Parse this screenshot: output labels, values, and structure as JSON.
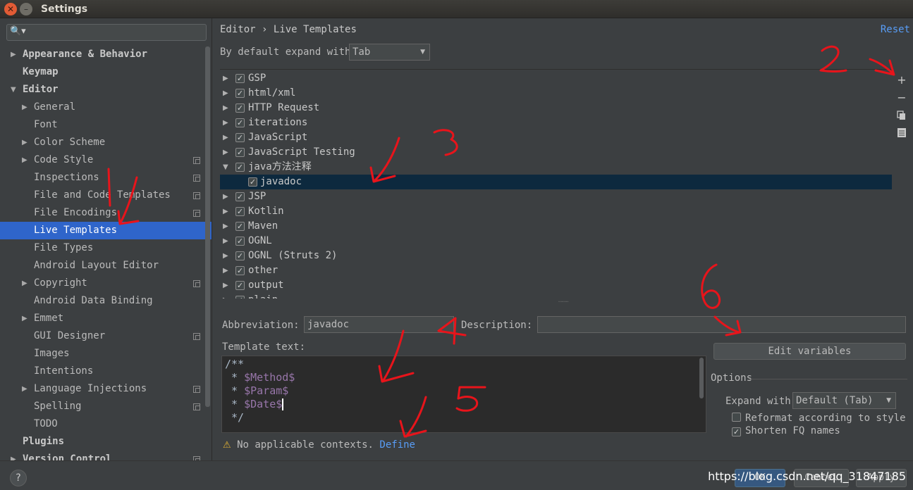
{
  "window": {
    "title": "Settings"
  },
  "search": {
    "placeholder": ""
  },
  "left_tree": [
    {
      "label": "Appearance & Behavior",
      "level": 0,
      "arrow": "right",
      "bold": true,
      "icon": false
    },
    {
      "label": "Keymap",
      "level": 0,
      "arrow": "none",
      "bold": true,
      "icon": false
    },
    {
      "label": "Editor",
      "level": 0,
      "arrow": "down",
      "bold": true,
      "icon": false
    },
    {
      "label": "General",
      "level": 1,
      "arrow": "right",
      "bold": false,
      "icon": false
    },
    {
      "label": "Font",
      "level": 1,
      "arrow": "none",
      "bold": false,
      "icon": false
    },
    {
      "label": "Color Scheme",
      "level": 1,
      "arrow": "right",
      "bold": false,
      "icon": false
    },
    {
      "label": "Code Style",
      "level": 1,
      "arrow": "right",
      "bold": false,
      "icon": true
    },
    {
      "label": "Inspections",
      "level": 1,
      "arrow": "none",
      "bold": false,
      "icon": true
    },
    {
      "label": "File and Code Templates",
      "level": 1,
      "arrow": "none",
      "bold": false,
      "icon": true
    },
    {
      "label": "File Encodings",
      "level": 1,
      "arrow": "none",
      "bold": false,
      "icon": true
    },
    {
      "label": "Live Templates",
      "level": 1,
      "arrow": "none",
      "bold": false,
      "icon": false,
      "selected": true
    },
    {
      "label": "File Types",
      "level": 1,
      "arrow": "none",
      "bold": false,
      "icon": false
    },
    {
      "label": "Android Layout Editor",
      "level": 1,
      "arrow": "none",
      "bold": false,
      "icon": false
    },
    {
      "label": "Copyright",
      "level": 1,
      "arrow": "right",
      "bold": false,
      "icon": true
    },
    {
      "label": "Android Data Binding",
      "level": 1,
      "arrow": "none",
      "bold": false,
      "icon": false
    },
    {
      "label": "Emmet",
      "level": 1,
      "arrow": "right",
      "bold": false,
      "icon": false
    },
    {
      "label": "GUI Designer",
      "level": 1,
      "arrow": "none",
      "bold": false,
      "icon": true
    },
    {
      "label": "Images",
      "level": 1,
      "arrow": "none",
      "bold": false,
      "icon": false
    },
    {
      "label": "Intentions",
      "level": 1,
      "arrow": "none",
      "bold": false,
      "icon": false
    },
    {
      "label": "Language Injections",
      "level": 1,
      "arrow": "right",
      "bold": false,
      "icon": true
    },
    {
      "label": "Spelling",
      "level": 1,
      "arrow": "none",
      "bold": false,
      "icon": true
    },
    {
      "label": "TODO",
      "level": 1,
      "arrow": "none",
      "bold": false,
      "icon": false
    },
    {
      "label": "Plugins",
      "level": 0,
      "arrow": "none",
      "bold": true,
      "icon": false
    },
    {
      "label": "Version Control",
      "level": 0,
      "arrow": "right",
      "bold": true,
      "icon": true
    }
  ],
  "breadcrumb": {
    "parent": "Editor",
    "separator": "›",
    "current": "Live Templates"
  },
  "reset_label": "Reset",
  "expand": {
    "label": "By default expand with",
    "value": "Tab"
  },
  "template_groups": [
    {
      "label": "GSP",
      "checked": true,
      "expanded": false,
      "child": false
    },
    {
      "label": "html/xml",
      "checked": true,
      "expanded": false,
      "child": false
    },
    {
      "label": "HTTP Request",
      "checked": true,
      "expanded": false,
      "child": false
    },
    {
      "label": "iterations",
      "checked": true,
      "expanded": false,
      "child": false
    },
    {
      "label": "JavaScript",
      "checked": true,
      "expanded": false,
      "child": false
    },
    {
      "label": "JavaScript Testing",
      "checked": true,
      "expanded": false,
      "child": false
    },
    {
      "label": "java方法注释",
      "checked": true,
      "expanded": true,
      "child": false
    },
    {
      "label": "javadoc",
      "checked": true,
      "expanded": false,
      "child": true,
      "selected": true
    },
    {
      "label": "JSP",
      "checked": true,
      "expanded": false,
      "child": false
    },
    {
      "label": "Kotlin",
      "checked": true,
      "expanded": false,
      "child": false
    },
    {
      "label": "Maven",
      "checked": true,
      "expanded": false,
      "child": false
    },
    {
      "label": "OGNL",
      "checked": true,
      "expanded": false,
      "child": false
    },
    {
      "label": "OGNL (Struts 2)",
      "checked": true,
      "expanded": false,
      "child": false
    },
    {
      "label": "other",
      "checked": true,
      "expanded": false,
      "child": false
    },
    {
      "label": "output",
      "checked": true,
      "expanded": false,
      "child": false
    },
    {
      "label": "plain",
      "checked": true,
      "expanded": false,
      "child": false
    }
  ],
  "toolbar": {
    "add": "+",
    "remove": "−",
    "copy": "copy-icon",
    "restore": "list-icon"
  },
  "abbreviation": {
    "label": "Abbreviation:",
    "value": "javadoc"
  },
  "description": {
    "label": "Description:",
    "value": ""
  },
  "template_text": {
    "label": "Template text:",
    "lines": [
      "/**",
      " * $Method$",
      " * $Param$",
      " * $Date$",
      " */"
    ]
  },
  "edit_variables_label": "Edit variables",
  "options": {
    "title": "Options",
    "expand_label": "Expand with",
    "expand_value": "Default (Tab)",
    "reformat_label": "Reformat according to style",
    "reformat_checked": false,
    "shorten_label": "Shorten FQ names",
    "shorten_checked": true
  },
  "warning": {
    "text": "No applicable contexts.",
    "link": "Define"
  },
  "buttons": {
    "ok": "OK",
    "cancel": "Cancel",
    "apply": "Apply",
    "help": "?"
  },
  "watermark": "https://blog.csdn.net/qq_31847185",
  "annotation_color": "#e8141b",
  "accent": "#2f65ca",
  "link_color": "#589df6"
}
